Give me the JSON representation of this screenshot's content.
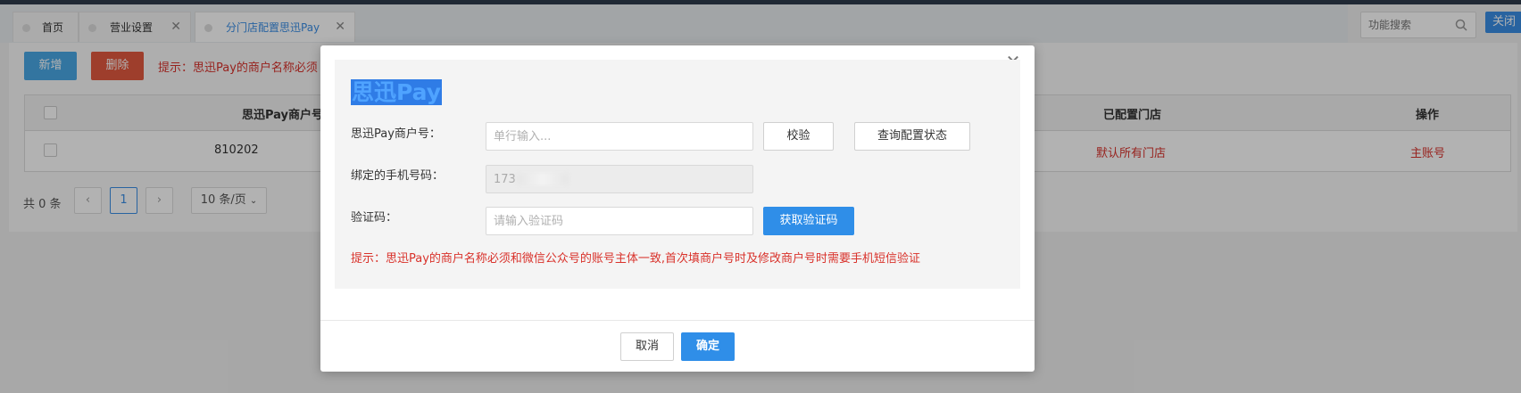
{
  "tabs": [
    {
      "label": "首页"
    },
    {
      "label": "营业设置"
    },
    {
      "label": "分门店配置思迅Pay"
    }
  ],
  "search": {
    "placeholder": "功能搜索"
  },
  "close_all_label": "关闭",
  "toolbar": {
    "add_label": "新增",
    "delete_label": "删除",
    "hint": "提示：思迅Pay的商户名称必须"
  },
  "table": {
    "headers": [
      "思迅Pay商户号",
      "已配置门店",
      "操作"
    ],
    "row": {
      "merchant_partial": "810202",
      "store": "默认所有门店",
      "action": "主账号"
    }
  },
  "pagination": {
    "total": "共 0 条",
    "prev": "‹",
    "page": "1",
    "next": "›",
    "page_size": "10 条/页"
  },
  "modal": {
    "brand": "思迅Pay",
    "merchant_label": "思迅Pay商户号：",
    "merchant_placeholder": "单行输入...",
    "verify_button": "校验",
    "query_button": "查询配置状态",
    "phone_label": "绑定的手机号码：",
    "phone_value": "173",
    "code_label": "验证码：",
    "code_placeholder": "请输入验证码",
    "get_code_button": "获取验证码",
    "hint": "提示：思迅Pay的商户名称必须和微信公众号的账号主体一致,首次填商户号时及修改商户号时需要手机短信验证",
    "cancel_button": "取消",
    "confirm_button": "确定"
  },
  "colors": {
    "primary": "#2f8ee8",
    "danger": "#d9322b",
    "delete_button": "#e25a3f",
    "add_button": "#4aa8e6"
  }
}
